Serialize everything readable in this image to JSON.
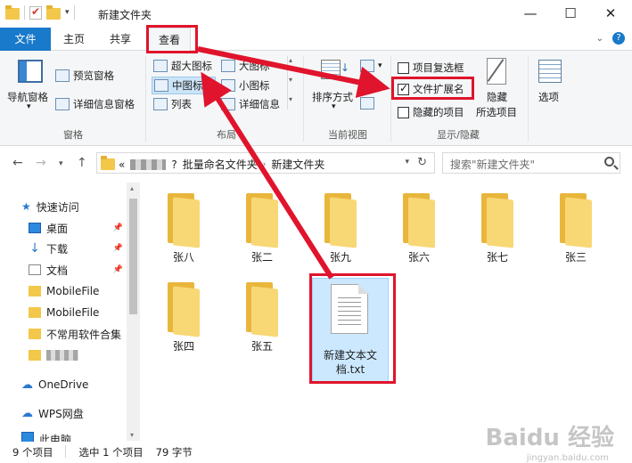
{
  "window": {
    "title": "新建文件夹",
    "minimize": "—",
    "maximize": "☐",
    "close": "✕"
  },
  "tabs": [
    {
      "label": "文件"
    },
    {
      "label": "主页"
    },
    {
      "label": "共享"
    },
    {
      "label": "查看"
    }
  ],
  "ribbon": {
    "panes": {
      "nav_pane": "导航窗格",
      "preview_pane": "预览窗格",
      "details_pane": "详细信息窗格",
      "group_label": "窗格"
    },
    "layout": {
      "xl_icons": "超大图标",
      "large_icons": "大图标",
      "medium_icons": "中图标",
      "small_icons": "小图标",
      "list": "列表",
      "details": "详细信息",
      "group_label": "布局"
    },
    "current_view": {
      "sort_by": "排序方式",
      "group_label": "当前视图"
    },
    "show_hide": {
      "item_checkboxes": "项目复选框",
      "item_checkboxes_checked": false,
      "file_extensions": "文件扩展名",
      "file_extensions_checked": true,
      "hidden_items": "隐藏的项目",
      "hidden_items_checked": false,
      "hide_selected": "隐藏",
      "hide_selected_2": "所选项目",
      "group_label": "显示/隐藏"
    },
    "options": "选项"
  },
  "address": {
    "prefix": "«",
    "crumb_1_tail": "?",
    "crumb_2": "批量命名文件夹",
    "crumb_3": "新建文件夹",
    "search_placeholder": "搜索\"新建文件夹\""
  },
  "nav": {
    "quick_access": "快速访问",
    "items": [
      {
        "label": "桌面",
        "pinned": true
      },
      {
        "label": "下载",
        "pinned": true
      },
      {
        "label": "文档",
        "pinned": true
      },
      {
        "label": "MobileFile",
        "pinned": false
      },
      {
        "label": "MobileFile",
        "pinned": false
      },
      {
        "label": "不常用软件合集",
        "pinned": false
      }
    ],
    "onedrive": "OneDrive",
    "wps": "WPS网盘",
    "thispc": "此电脑"
  },
  "files": [
    {
      "name": "张八"
    },
    {
      "name": "张二"
    },
    {
      "name": "张九"
    },
    {
      "name": "张六"
    },
    {
      "name": "张七"
    },
    {
      "name": "张三"
    },
    {
      "name": "张四"
    },
    {
      "name": "张五"
    },
    {
      "name": "新建文本文档.txt",
      "line1": "新建文本文",
      "line2": "档.txt",
      "selected": true
    }
  ],
  "status": {
    "count": "9 个项目",
    "selected": "选中 1 个项目",
    "size": "79 字节"
  },
  "colors": {
    "accent": "#1979ca",
    "annotation": "#e0142c",
    "folder": "#f3c74a",
    "selection": "#cce8ff"
  },
  "watermark": {
    "brand": "Baidu 经验",
    "url": "jingyan.baidu.com"
  }
}
